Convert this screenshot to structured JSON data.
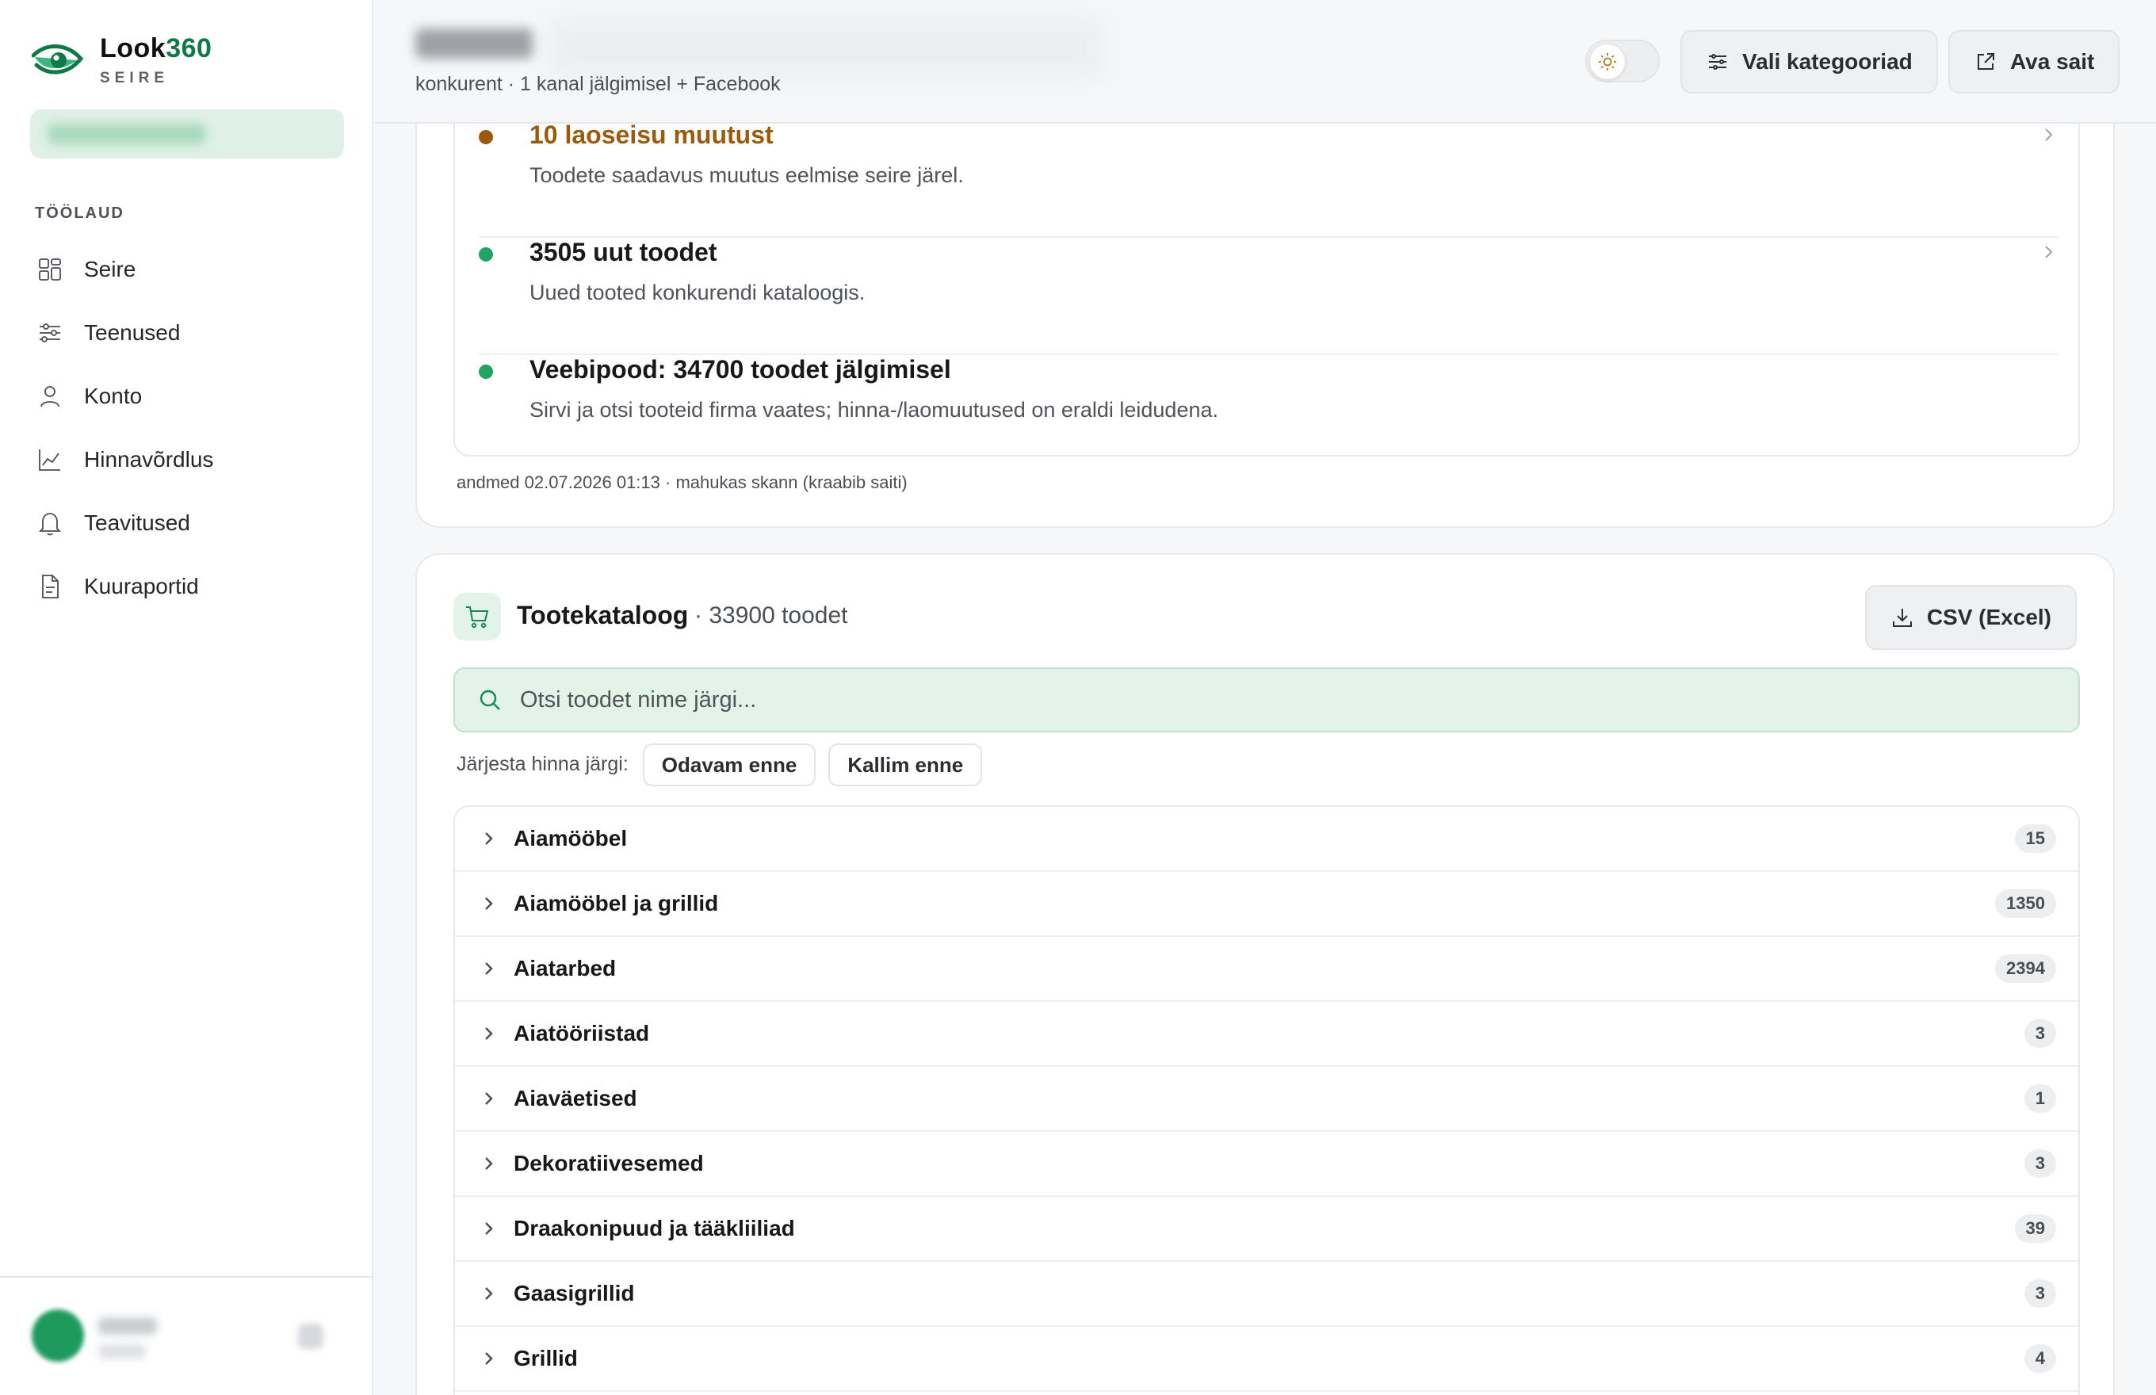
{
  "brand": {
    "name_main": "Look",
    "name_accent": "360",
    "subtitle": "SEIRE",
    "accent_color": "#0f7a48"
  },
  "sidebar": {
    "section_label": "TÖÖLAUD",
    "items": [
      {
        "label": "Seire",
        "icon": "grid-icon"
      },
      {
        "label": "Teenused",
        "icon": "sliders-icon"
      },
      {
        "label": "Konto",
        "icon": "user-icon"
      },
      {
        "label": "Hinnavõrdlus",
        "icon": "chart-line-icon"
      },
      {
        "label": "Teavitused",
        "icon": "bell-icon"
      },
      {
        "label": "Kuuraportid",
        "icon": "document-icon"
      }
    ]
  },
  "header": {
    "subtitle": "konkurent · 1 kanal jälgimisel + Facebook",
    "categories_button": "Vali kategooriad",
    "open_site_button": "Ava sait"
  },
  "changes": {
    "items": [
      {
        "title": "10 laoseisu muutust",
        "description": "Toodete saadavus muutus eelmise seire järel.",
        "color": "#9a5b0c",
        "dot_color": "#9a5b0c"
      },
      {
        "title": "3505 uut toodet",
        "description": "Uued tooted konkurendi kataloogis.",
        "color": "#17181b",
        "dot_color": "#1fa463"
      },
      {
        "title": "Veebipood: 34700 toodet jälgimisel",
        "description": "Sirvi ja otsi tooteid firma vaates; hinna-/laomuutused on eraldi leidudena.",
        "color": "#17181b",
        "dot_color": "#1fa463"
      }
    ],
    "data_stamp": "andmed 02.07.2026 01:13 · mahukas skann (kraabib saiti)"
  },
  "catalog": {
    "title": "Tootekataloog",
    "count": "· 33900 toodet",
    "csv_button": "CSV (Excel)",
    "search_placeholder": "Otsi toodet nime järgi...",
    "sort_label": "Järjesta hinna järgi:",
    "sort_cheaper": "Odavam enne",
    "sort_pricier": "Kallim enne",
    "categories": [
      {
        "name": "Aiamööbel",
        "count": "15"
      },
      {
        "name": "Aiamööbel ja grillid",
        "count": "1350"
      },
      {
        "name": "Aiatarbed",
        "count": "2394"
      },
      {
        "name": "Aiatööriistad",
        "count": "3"
      },
      {
        "name": "Aiaväetised",
        "count": "1"
      },
      {
        "name": "Dekoratiivesemed",
        "count": "3"
      },
      {
        "name": "Draakonipuud ja tääkliiliad",
        "count": "39"
      },
      {
        "name": "Gaasigrillid",
        "count": "3"
      },
      {
        "name": "Grillid",
        "count": "4"
      }
    ]
  }
}
